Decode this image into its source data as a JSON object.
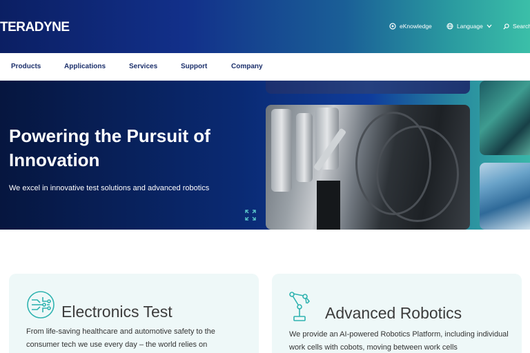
{
  "header": {
    "logo": "TERADYNE",
    "utility": {
      "eknowledge": "eKnowledge",
      "language": "Language",
      "search": "Search"
    }
  },
  "nav": {
    "items": [
      "Products",
      "Applications",
      "Services",
      "Support",
      "Company"
    ]
  },
  "hero": {
    "title": "Powering the Pursuit of Innovation",
    "subtitle": "We excel in innovative test solutions and advanced robotics"
  },
  "cards": [
    {
      "title": "Electronics Test",
      "description": "From life-saving healthcare and automotive safety to the consumer tech we use every day – the world relies on"
    },
    {
      "title": "Advanced Robotics",
      "description": "We provide an AI-powered Robotics Platform, including individual work cells with cobots, moving between work cells"
    }
  ],
  "colors": {
    "brand_navy": "#1b2f6b",
    "accent_teal": "#2fb3b0",
    "card_bg": "#eef8f8"
  },
  "icons": {
    "eknowledge": "globe-gear-icon",
    "language": "globe-icon",
    "search": "magnifier-icon",
    "expand": "expand-arrows-icon",
    "electronics": "circuit-chip-icon",
    "robotics": "robot-arm-icon"
  }
}
